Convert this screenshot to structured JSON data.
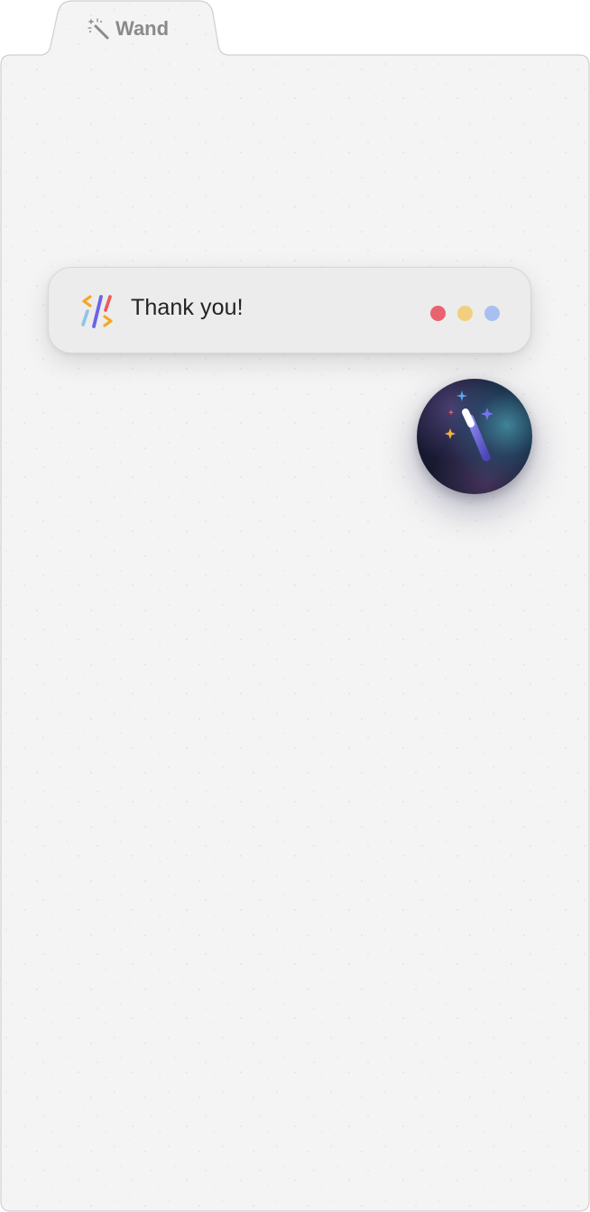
{
  "tab": {
    "label": "Wand",
    "icon": "magic-wand-icon"
  },
  "toast": {
    "message": "Thank you!",
    "logo_icon": "code-logo-icon",
    "dots": [
      {
        "name": "red-dot",
        "color": "#e8636f"
      },
      {
        "name": "yellow-dot",
        "color": "#f2cf7e"
      },
      {
        "name": "blue-dot",
        "color": "#a9bff0"
      }
    ]
  },
  "fab": {
    "icon": "magic-wand-sparkles-icon"
  },
  "colors": {
    "panel_background": "#f4f4f4",
    "panel_border": "#cfcfcf",
    "tab_text": "#8a8a8a",
    "accent_purple": "#6b63e8",
    "accent_orange": "#f5a623",
    "accent_red": "#ee5a5a",
    "accent_blue": "#8fc3ea"
  }
}
